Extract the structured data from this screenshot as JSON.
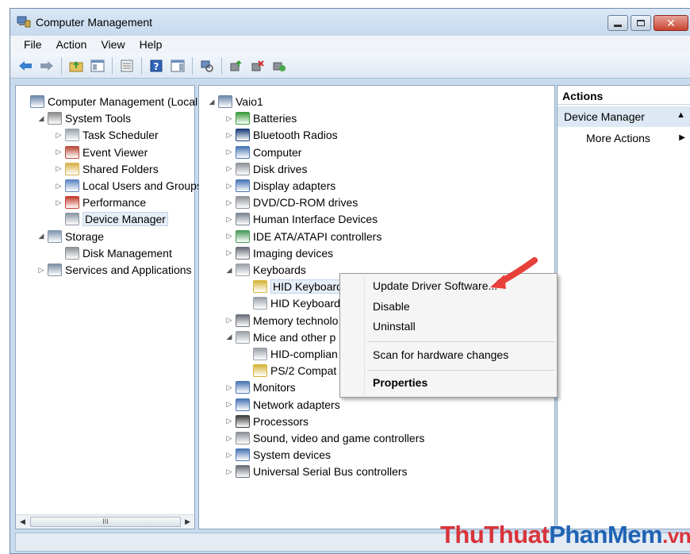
{
  "window": {
    "title": "Computer Management"
  },
  "menu": [
    "File",
    "Action",
    "View",
    "Help"
  ],
  "left_tree": [
    {
      "label": "Computer Management (Local",
      "arrow": "",
      "indent": 0,
      "icon": "computer-management-icon",
      "color": "#6b86a8"
    },
    {
      "label": "System Tools",
      "arrow": "◢",
      "indent": 1,
      "icon": "tools-icon",
      "color": "#8a8a8a"
    },
    {
      "label": "Task Scheduler",
      "arrow": "▷",
      "indent": 2,
      "icon": "clock-icon",
      "color": "#9aa3ad"
    },
    {
      "label": "Event Viewer",
      "arrow": "▷",
      "indent": 2,
      "icon": "event-viewer-icon",
      "color": "#b84b3a"
    },
    {
      "label": "Shared Folders",
      "arrow": "▷",
      "indent": 2,
      "icon": "shared-folder-icon",
      "color": "#d9b24a"
    },
    {
      "label": "Local Users and Groups",
      "arrow": "▷",
      "indent": 2,
      "icon": "users-icon",
      "color": "#5f86c2"
    },
    {
      "label": "Performance",
      "arrow": "▷",
      "indent": 2,
      "icon": "performance-icon",
      "color": "#c23b2b"
    },
    {
      "label": "Device Manager",
      "arrow": "",
      "indent": 2,
      "icon": "device-manager-icon",
      "color": "#8c97a5",
      "selected": true
    },
    {
      "label": "Storage",
      "arrow": "◢",
      "indent": 1,
      "icon": "storage-icon",
      "color": "#7f95b0"
    },
    {
      "label": "Disk Management",
      "arrow": "",
      "indent": 2,
      "icon": "disk-management-icon",
      "color": "#8d9299"
    },
    {
      "label": "Services and Applications",
      "arrow": "▷",
      "indent": 1,
      "icon": "services-icon",
      "color": "#7e8fa6"
    }
  ],
  "scrollbar": {
    "left": "◀",
    "right": "▶",
    "thumb": "III"
  },
  "device_tree": [
    {
      "label": "Vaio1",
      "arrow": "◢",
      "indent": 0,
      "icon": "computer-icon",
      "color": "#6b86a8"
    },
    {
      "label": "Batteries",
      "arrow": "▷",
      "indent": 1,
      "icon": "battery-icon",
      "color": "#3d9a3d"
    },
    {
      "label": "Bluetooth Radios",
      "arrow": "▷",
      "indent": 1,
      "icon": "bluetooth-icon",
      "color": "#1b3f7a"
    },
    {
      "label": "Computer",
      "arrow": "▷",
      "indent": 1,
      "icon": "computer-icon",
      "color": "#4a76b5"
    },
    {
      "label": "Disk drives",
      "arrow": "▷",
      "indent": 1,
      "icon": "disk-drive-icon",
      "color": "#8d9299"
    },
    {
      "label": "Display adapters",
      "arrow": "▷",
      "indent": 1,
      "icon": "display-adapter-icon",
      "color": "#4a76b5"
    },
    {
      "label": "DVD/CD-ROM drives",
      "arrow": "▷",
      "indent": 1,
      "icon": "dvd-drive-icon",
      "color": "#8d9299"
    },
    {
      "label": "Human Interface Devices",
      "arrow": "▷",
      "indent": 1,
      "icon": "hid-icon",
      "color": "#7b8594"
    },
    {
      "label": "IDE ATA/ATAPI controllers",
      "arrow": "▷",
      "indent": 1,
      "icon": "ide-controller-icon",
      "color": "#4a9a5a"
    },
    {
      "label": "Imaging devices",
      "arrow": "▷",
      "indent": 1,
      "icon": "camera-icon",
      "color": "#6a6f78"
    },
    {
      "label": "Keyboards",
      "arrow": "◢",
      "indent": 1,
      "icon": "keyboard-icon",
      "color": "#9aa0a8"
    },
    {
      "label": "HID Keyboard",
      "arrow": "",
      "indent": 2,
      "icon": "keyboard-warning-icon",
      "color": "#d6b43a",
      "selected": true
    },
    {
      "label": "HID Keyboard",
      "arrow": "",
      "indent": 2,
      "icon": "keyboard-icon",
      "color": "#9aa0a8"
    },
    {
      "label": "Memory technolo",
      "arrow": "▷",
      "indent": 1,
      "icon": "memory-icon",
      "color": "#6a6f78"
    },
    {
      "label": "Mice and other p",
      "arrow": "◢",
      "indent": 1,
      "icon": "mouse-icon",
      "color": "#9aa0a8"
    },
    {
      "label": "HID-complian",
      "arrow": "",
      "indent": 2,
      "icon": "mouse-icon",
      "color": "#9aa0a8"
    },
    {
      "label": "PS/2 Compat",
      "arrow": "",
      "indent": 2,
      "icon": "mouse-warning-icon",
      "color": "#d6b43a"
    },
    {
      "label": "Monitors",
      "arrow": "▷",
      "indent": 1,
      "icon": "monitor-icon",
      "color": "#4a76b5"
    },
    {
      "label": "Network adapters",
      "arrow": "▷",
      "indent": 1,
      "icon": "network-adapter-icon",
      "color": "#4a76b5"
    },
    {
      "label": "Processors",
      "arrow": "▷",
      "indent": 1,
      "icon": "processor-icon",
      "color": "#3c3c3c"
    },
    {
      "label": "Sound, video and game controllers",
      "arrow": "▷",
      "indent": 1,
      "icon": "speaker-icon",
      "color": "#8d9299"
    },
    {
      "label": "System devices",
      "arrow": "▷",
      "indent": 1,
      "icon": "system-devices-icon",
      "color": "#4a76b5"
    },
    {
      "label": "Universal Serial Bus controllers",
      "arrow": "▷",
      "indent": 1,
      "icon": "usb-icon",
      "color": "#6a6f78"
    }
  ],
  "actions": {
    "header": "Actions",
    "group": "Device Manager",
    "group_arrow": "▲",
    "more": "More Actions",
    "more_arrow": "▶"
  },
  "context_menu": {
    "update": "Update Driver Software...",
    "disable": "Disable",
    "uninstall": "Uninstall",
    "scan": "Scan for hardware changes",
    "properties": "Properties"
  },
  "watermark": {
    "part1": "ThuThuat",
    "part2": "PhanMem",
    "part3": ".vn"
  },
  "colors": {
    "accent_red": "#e8403a",
    "title_bg": "#c5d9ee"
  }
}
